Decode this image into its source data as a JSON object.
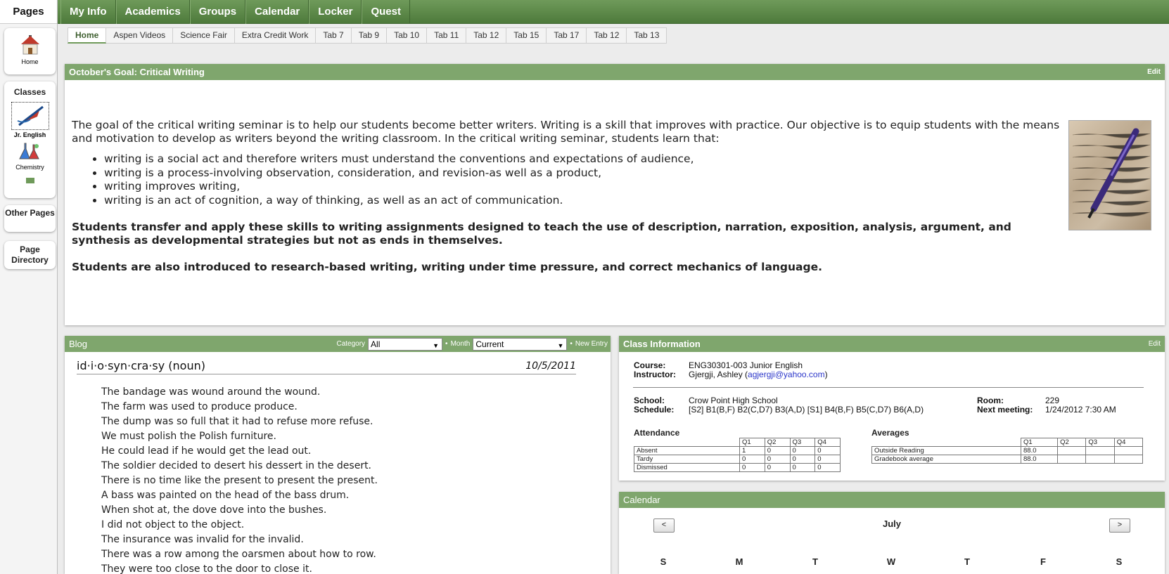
{
  "sidebar": {
    "title": "Pages",
    "home_label": "Home",
    "classes_label": "Classes",
    "class_items": [
      {
        "label": "Jr. English"
      },
      {
        "label": "Chemistry"
      }
    ],
    "other_pages_label": "Other Pages",
    "page_directory_label": "Page Directory"
  },
  "topnav": [
    "My Info",
    "Academics",
    "Groups",
    "Calendar",
    "Locker",
    "Quest"
  ],
  "subtabs": [
    "Home",
    "Aspen Videos",
    "Science Fair",
    "Extra Credit Work",
    "Tab 7",
    "Tab 9",
    "Tab 10",
    "Tab 11",
    "Tab 12",
    "Tab 15",
    "Tab 17",
    "Tab 12",
    "Tab 13"
  ],
  "goal": {
    "title": "October's Goal: Critical Writing",
    "edit_label": "Edit",
    "intro": "The goal of the critical writing seminar is to help our students become better writers. Writing is a skill that improves with practice. Our objective is to equip students with the means and motivation to develop as writers beyond the writing classroom. In the critical writing seminar, students learn that:",
    "bullets": [
      "writing is a social act and therefore writers must understand the conventions and expectations of audience,",
      "writing is a process-involving observation, consideration, and revision-as well as a product,",
      "writing improves writing,",
      "writing is an act of cognition, a way of thinking, as well as an act of communication."
    ],
    "para2": "Students transfer and apply these skills to writing assignments designed to teach the use of description, narration, exposition, analysis, argument, and synthesis as developmental strategies but not as ends in themselves.",
    "para3": "Students are also introduced to research-based writing, writing under time pressure, and correct mechanics of language."
  },
  "blog": {
    "title": "Blog",
    "category_label": "Category",
    "category_value": "All",
    "month_label": "Month",
    "month_value": "Current",
    "new_entry_label": "New Entry",
    "entry_title": "id·i·o·syn·cra·sy (noun)",
    "entry_date": "10/5/2011",
    "lines": [
      "The bandage was wound around the wound.",
      "The farm was used to produce produce.",
      "The dump was so full that it had to refuse more refuse.",
      "We must polish the Polish furniture.",
      "He could lead if he would get the lead out.",
      "The soldier decided to desert his dessert in the desert.",
      "There is no time like the present to present the present.",
      "A bass was painted on the head of the bass drum.",
      "When shot at, the dove dove into the bushes.",
      "I did not object to the object.",
      "The insurance was invalid for the invalid.",
      "There was a row among the oarsmen about how to row.",
      "They were too close to the door to close it."
    ]
  },
  "classinfo": {
    "title": "Class Information",
    "edit_label": "Edit",
    "course_label": "Course:",
    "course_value": "ENG30301-003 Junior English",
    "instructor_label": "Instructor:",
    "instructor_name": "Gjergji, Ashley (",
    "instructor_email": "agjergji@yahoo.com",
    "instructor_close": ")",
    "school_label": "School:",
    "school_value": "Crow Point High School",
    "schedule_label": "Schedule:",
    "schedule_value": "[S2] B1(B,F) B2(C,D7) B3(A,D) [S1] B4(B,F) B5(C,D7) B6(A,D)",
    "room_label": "Room:",
    "room_value": "229",
    "next_label": "Next meeting:",
    "next_value": "1/24/2012 7:30 AM",
    "attendance": {
      "title": "Attendance",
      "cols": [
        "Q1",
        "Q2",
        "Q3",
        "Q4"
      ],
      "rows": [
        {
          "label": "Absent",
          "vals": [
            "1",
            "0",
            "0",
            "0"
          ]
        },
        {
          "label": "Tardy",
          "vals": [
            "0",
            "0",
            "0",
            "0"
          ]
        },
        {
          "label": "Dismissed",
          "vals": [
            "0",
            "0",
            "0",
            "0"
          ]
        }
      ]
    },
    "averages": {
      "title": "Averages",
      "cols": [
        "Q1",
        "Q2",
        "Q3",
        "Q4"
      ],
      "rows": [
        {
          "label": "Outside Reading",
          "vals": [
            "88.0",
            "",
            "",
            ""
          ]
        },
        {
          "label": "Gradebook average",
          "vals": [
            "88.0",
            "",
            "",
            ""
          ]
        }
      ]
    }
  },
  "calendar": {
    "title": "Calendar",
    "month": "July",
    "prev_label": "<",
    "next_label": ">",
    "days": [
      "S",
      "M",
      "T",
      "W",
      "T",
      "F",
      "S"
    ]
  },
  "colors": {
    "accent_green": "#7fa66d",
    "nav_green": "#4d7a3b",
    "link_blue": "#2a35c9"
  }
}
